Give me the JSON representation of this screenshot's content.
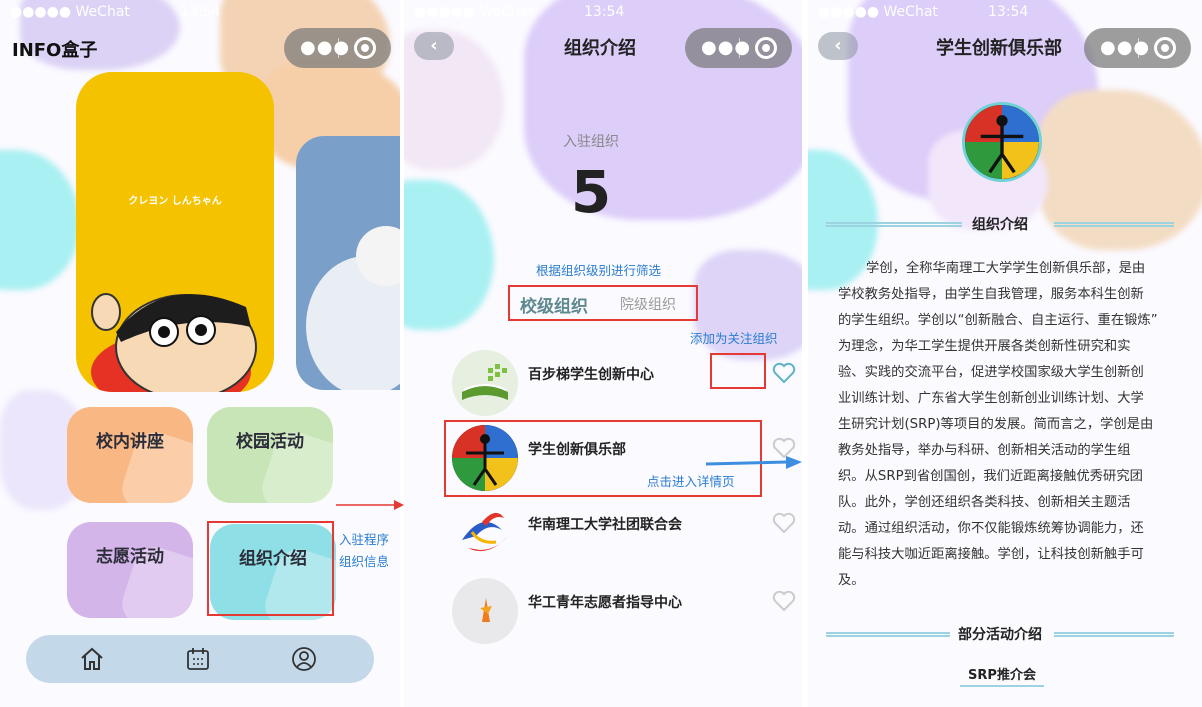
{
  "status_bar": {
    "carrier": "●●●●● WeChat",
    "time": "13:54"
  },
  "screen_home": {
    "app_title": "INFO盒子",
    "banner": {
      "text": "クレヨン しんちゃん"
    },
    "tiles": [
      {
        "label": "校内讲座",
        "color": "#f9b883"
      },
      {
        "label": "校园活动",
        "color": "#c7e5b7"
      },
      {
        "label": "志愿活动",
        "color": "#d4b5ea"
      },
      {
        "label": "组织介绍",
        "color": "#8fdfe6"
      }
    ],
    "annotation": {
      "line1": "入驻程序",
      "line2": "组织信息"
    },
    "tabbar": {
      "items": [
        "home-icon",
        "calendar-icon",
        "user-icon"
      ]
    }
  },
  "screen_list": {
    "title": "组织介绍",
    "count_label": "入驻组织",
    "count_value": "5",
    "filter_hint": "根据组织级别进行筛选",
    "tabs": [
      {
        "label": "校级组织",
        "active": true
      },
      {
        "label": "院级组织",
        "active": false
      }
    ],
    "follow_hint": "添加为关注组织",
    "detail_hint": "点击进入详情页",
    "orgs": [
      {
        "name": "百步梯学生创新中心",
        "followed": true
      },
      {
        "name": "学生创新俱乐部",
        "followed": false
      },
      {
        "name": "华南理工大学社团联合会",
        "followed": false
      },
      {
        "name": "华工青年志愿者指导中心",
        "followed": false
      }
    ]
  },
  "screen_detail": {
    "title": "学生创新俱乐部",
    "section_intro": "组织介绍",
    "intro_lines": [
      "学创，全称华南理工大学学生创新俱乐部，是由",
      "学校教务处指导，由学生自我管理，服务本科生创新",
      "的学生组织。学创以“创新融合、自主运行、重在锻炼”",
      "为理念，为华工学生提供开展各类创新性研究和实",
      "验、实践的交流平台，促进学校国家级大学生创新创",
      "业训练计划、广东省大学生创新创业训练计划、大学",
      "生研究计划(SRP)等项目的发展。简而言之，学创是由",
      "教务处指导，举办与科研、创新相关活动的学生组",
      "织。从SRP到省创国创，我们近距离接触优秀研究团",
      "队。此外，学创还组织各类科技、创新相关主题活",
      "动。通过组织活动，你不仅能锻炼统筹协调能力，还",
      "能与科技大咖近距离接触。学创，让科技创新触手可",
      "及。"
    ],
    "section_activities": "部分活动介绍",
    "subtab": "SRP推介会"
  },
  "colors": {
    "accent_teal": "#5fb3c4",
    "annotation_blue": "#2a7dd0",
    "highlight_red": "#e53935"
  }
}
